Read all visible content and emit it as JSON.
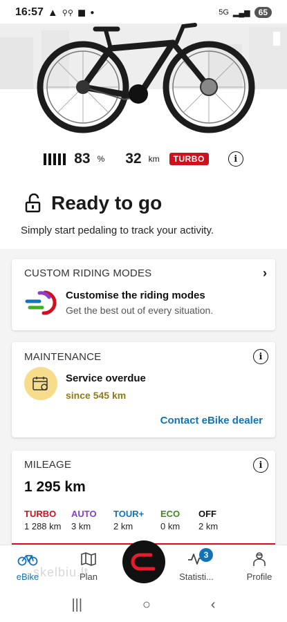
{
  "status_bar": {
    "time": "16:57",
    "network": "5G",
    "battery": "65"
  },
  "hero": {
    "bike_color": "#1c1c1c"
  },
  "stats": {
    "battery_percent": "83",
    "battery_unit": "%",
    "range": "32",
    "range_unit": "km",
    "mode_badge": "TURBO",
    "battery_bars": 5
  },
  "ready": {
    "title": "Ready to go",
    "subtitle": "Simply start pedaling to track your activity."
  },
  "riding_modes_card": {
    "header": "CUSTOM RIDING MODES",
    "title": "Customise the riding modes",
    "description": "Get the best out of every situation."
  },
  "maintenance_card": {
    "header": "MAINTENANCE",
    "title": "Service overdue",
    "subtitle": "since 545 km",
    "link": "Contact eBike dealer"
  },
  "mileage_card": {
    "header": "MILEAGE",
    "total": "1 295 km",
    "modes": [
      {
        "name": "TURBO",
        "value": "1 288 km",
        "color": "#d0101c"
      },
      {
        "name": "AUTO",
        "value": "3 km",
        "color": "#8a3fc7"
      },
      {
        "name": "TOUR+",
        "value": "2 km",
        "color": "#1273b9"
      },
      {
        "name": "ECO",
        "value": "0 km",
        "color": "#3f8a1e"
      },
      {
        "name": "OFF",
        "value": "2 km",
        "color": "#111111"
      }
    ]
  },
  "bottom_nav": {
    "items": [
      {
        "label": "eBike"
      },
      {
        "label": "Plan"
      },
      {
        "label": "Statisti..."
      },
      {
        "label": "Profile"
      }
    ],
    "stats_badge": "3"
  },
  "watermark": "skelbiu.lt",
  "colors": {
    "accent": "#1273b9",
    "turbo_red": "#d0101c",
    "maintenance_yellow": "#f7dc8c"
  }
}
